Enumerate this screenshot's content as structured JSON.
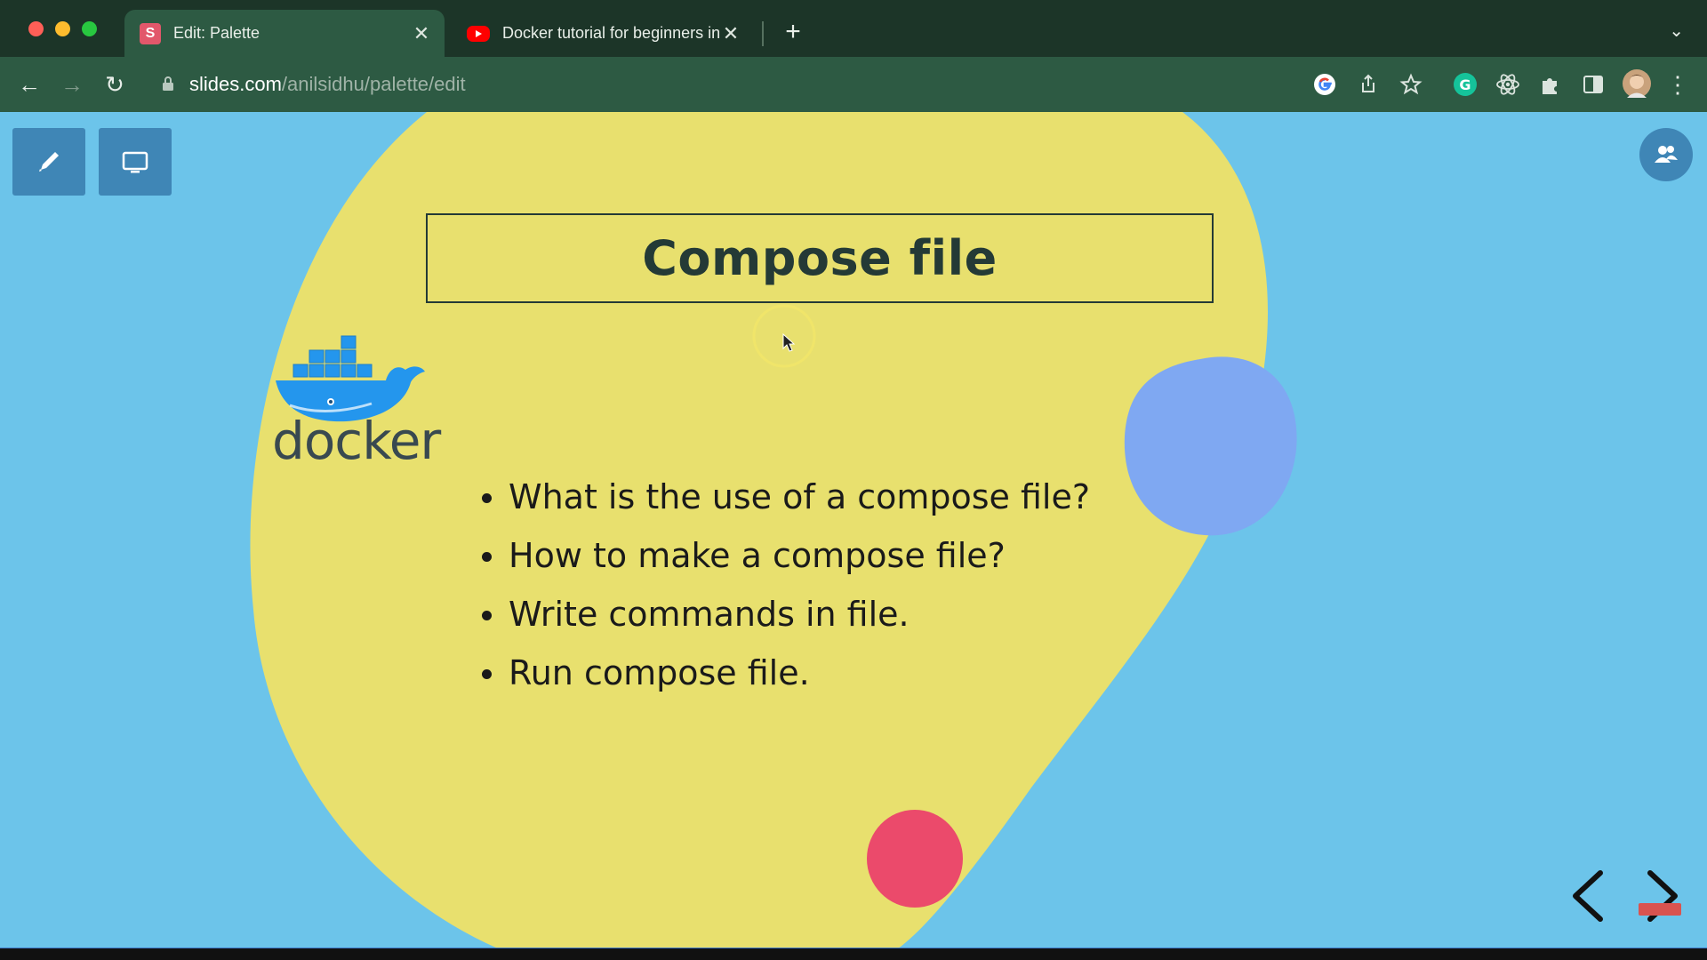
{
  "browser": {
    "tabs": [
      {
        "label": "Edit: Palette",
        "favicon": "S",
        "active": true
      },
      {
        "label": "Docker tutorial for beginners in",
        "favicon": "youtube-icon",
        "active": false
      }
    ],
    "url_host": "slides.com",
    "url_path": "/anilsidhu/palette/edit"
  },
  "slide": {
    "title": "Compose file",
    "logo_text": "docker",
    "bullets": [
      "What is the use of a compose file?",
      "How to make a compose file?",
      "Write commands in file.",
      "Run compose file."
    ]
  },
  "colors": {
    "background": "#6cc4ea",
    "blob_yellow": "#e8e06e",
    "blob_blue": "#7fa8f2",
    "blob_pink": "#eb4a6b",
    "docker_blue": "#2496ed"
  }
}
